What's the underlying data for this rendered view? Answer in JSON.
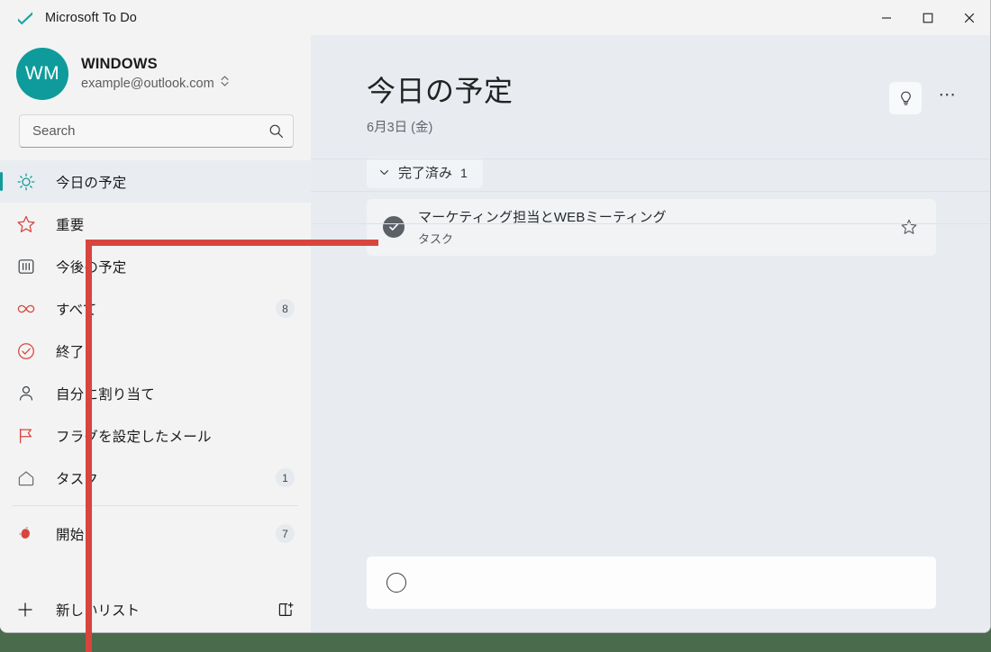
{
  "window": {
    "title": "Microsoft To Do",
    "logo_icon": "check-logo-icon",
    "minimize_label": "–",
    "maximize_label": "□",
    "close_label": "×"
  },
  "account": {
    "initials": "WM",
    "name": "WINDOWS",
    "email": "example@outlook.com",
    "switcher_icon": "chevron-up-down-icon",
    "avatar_color": "#0f9b9b"
  },
  "search": {
    "placeholder": "Search",
    "value": "",
    "icon": "search-icon"
  },
  "sidebar": {
    "items": [
      {
        "id": "today",
        "label": "今日の予定",
        "icon": "sun-icon",
        "count": "",
        "selected": true,
        "separator_after": false
      },
      {
        "id": "important",
        "label": "重要",
        "icon": "star-icon",
        "count": "",
        "selected": false,
        "separator_after": false
      },
      {
        "id": "planned",
        "label": "今後の予定",
        "icon": "calendar-icon",
        "count": "",
        "selected": false,
        "separator_after": false
      },
      {
        "id": "all",
        "label": "すべて",
        "icon": "infinity-icon",
        "count": "8",
        "selected": false,
        "separator_after": false
      },
      {
        "id": "completed",
        "label": "終了",
        "icon": "check-circle-icon",
        "count": "",
        "selected": false,
        "separator_after": false
      },
      {
        "id": "assigned",
        "label": "自分に割り当て",
        "icon": "person-icon",
        "count": "",
        "selected": false,
        "separator_after": false
      },
      {
        "id": "flagged",
        "label": "フラグを設定したメール",
        "icon": "flag-icon",
        "count": "",
        "selected": false,
        "separator_after": false
      },
      {
        "id": "tasks",
        "label": "タスク",
        "icon": "home-icon",
        "count": "1",
        "selected": false,
        "separator_after": true
      },
      {
        "id": "start",
        "label": "開始",
        "icon": "red-emoji-icon",
        "count": "7",
        "selected": false,
        "separator_after": false
      }
    ],
    "new_list": {
      "label": "新しいリスト",
      "plus_icon": "plus-icon",
      "new_group_icon": "new-group-icon"
    }
  },
  "main": {
    "title": "今日の予定",
    "date": "6月3日 (金)",
    "bulb_icon": "lightbulb-icon",
    "more_icon": "more-options-icon",
    "completed_group": {
      "chevron_icon": "chevron-down-icon",
      "label": "完了済み",
      "count": "1"
    },
    "tasks": [
      {
        "title": "マーケティング担当とWEBミーティング",
        "subtitle": "タスク",
        "completed": true,
        "check_icon": "checked-circle-icon",
        "star_icon": "star-outline-icon"
      }
    ],
    "add_task": {
      "placeholder": "",
      "value": "",
      "circle_icon": "empty-circle-icon"
    }
  },
  "annotation": {
    "color": "#d8453e",
    "shape": "elbow-pointer"
  }
}
